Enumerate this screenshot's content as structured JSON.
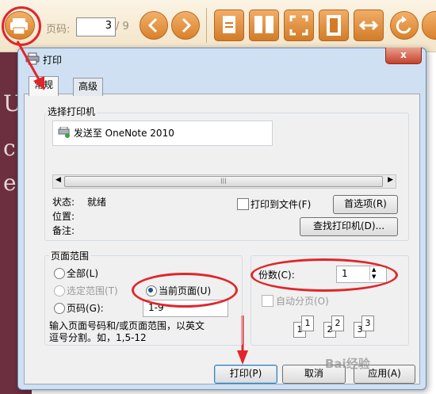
{
  "toolbar": {
    "page_label": "页码:",
    "page_value": "3",
    "page_total": "/ 9",
    "icons": [
      "printer-icon",
      "prev-page-icon",
      "next-page-icon",
      "single-page-icon",
      "two-page-icon",
      "fit-page-icon",
      "filmstrip-icon",
      "fit-width-icon",
      "rotate-icon",
      "nav-icon"
    ]
  },
  "background_letters": [
    "U",
    "c",
    "e"
  ],
  "dialog": {
    "title": "打印",
    "close": "x",
    "tabs": [
      "常规",
      "高级"
    ],
    "select_printer": {
      "label": "选择打印机",
      "printer": "发送至 OneNote 2010",
      "status_label": "状态:",
      "status_value": "就绪",
      "location_label": "位置:",
      "comment_label": "备注:",
      "print_to_file": "打印到文件(F)",
      "preferences": "首选项(R)",
      "find_printer": "查找打印机(D)..."
    },
    "page_range": {
      "label": "页面范围",
      "all": "全部(L)",
      "selection": "选定范围(T)",
      "current": "当前页面(U)",
      "pages": "页码(G):",
      "pages_value": "1-9",
      "hint_line1": "输入页面号码和/或页面范围，以英文",
      "hint_line2": "逗号分割。如，1,5-12"
    },
    "copies": {
      "label": "份数(C):",
      "value": "1",
      "collate": "自动分页(O)",
      "collate_pages": [
        "1",
        "1",
        "2",
        "2",
        "3",
        "3"
      ]
    },
    "buttons": {
      "print": "打印(P)",
      "cancel": "取消",
      "apply": "应用(A)"
    }
  },
  "watermark": "Bai经验",
  "colors": {
    "toolbar_orange": "#d9812b",
    "highlight_red": "#e0262b",
    "dialog_frame": "#cfe0f3"
  }
}
